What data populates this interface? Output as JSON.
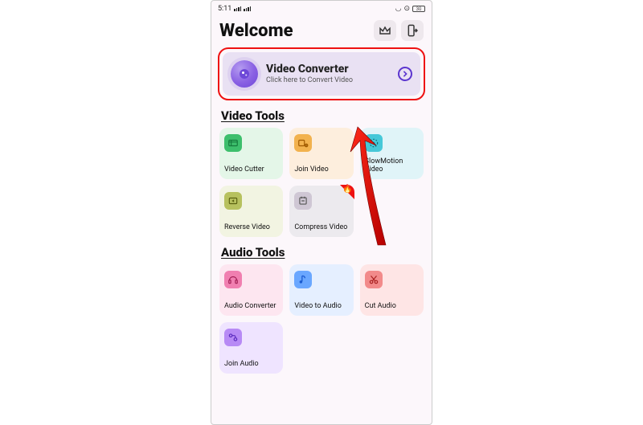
{
  "status": {
    "time": "5:11",
    "battery": "30"
  },
  "header": {
    "title": "Welcome"
  },
  "hero": {
    "title": "Video Converter",
    "subtitle": "Click here to Convert Video"
  },
  "sections": {
    "video": {
      "title": "Video Tools",
      "tiles": {
        "cutter": {
          "label": "Video Cutter"
        },
        "join": {
          "label": "Join Video"
        },
        "slowmo": {
          "label": "SlowMotion Video"
        },
        "reverse": {
          "label": "Reverse Video"
        },
        "compress": {
          "label": "Compress Video"
        }
      }
    },
    "audio": {
      "title": "Audio Tools",
      "tiles": {
        "converter": {
          "label": "Audio Converter"
        },
        "vid2aud": {
          "label": "Video to Audio"
        },
        "cut": {
          "label": "Cut Audio"
        },
        "joinaud": {
          "label": "Join Audio"
        }
      }
    }
  }
}
